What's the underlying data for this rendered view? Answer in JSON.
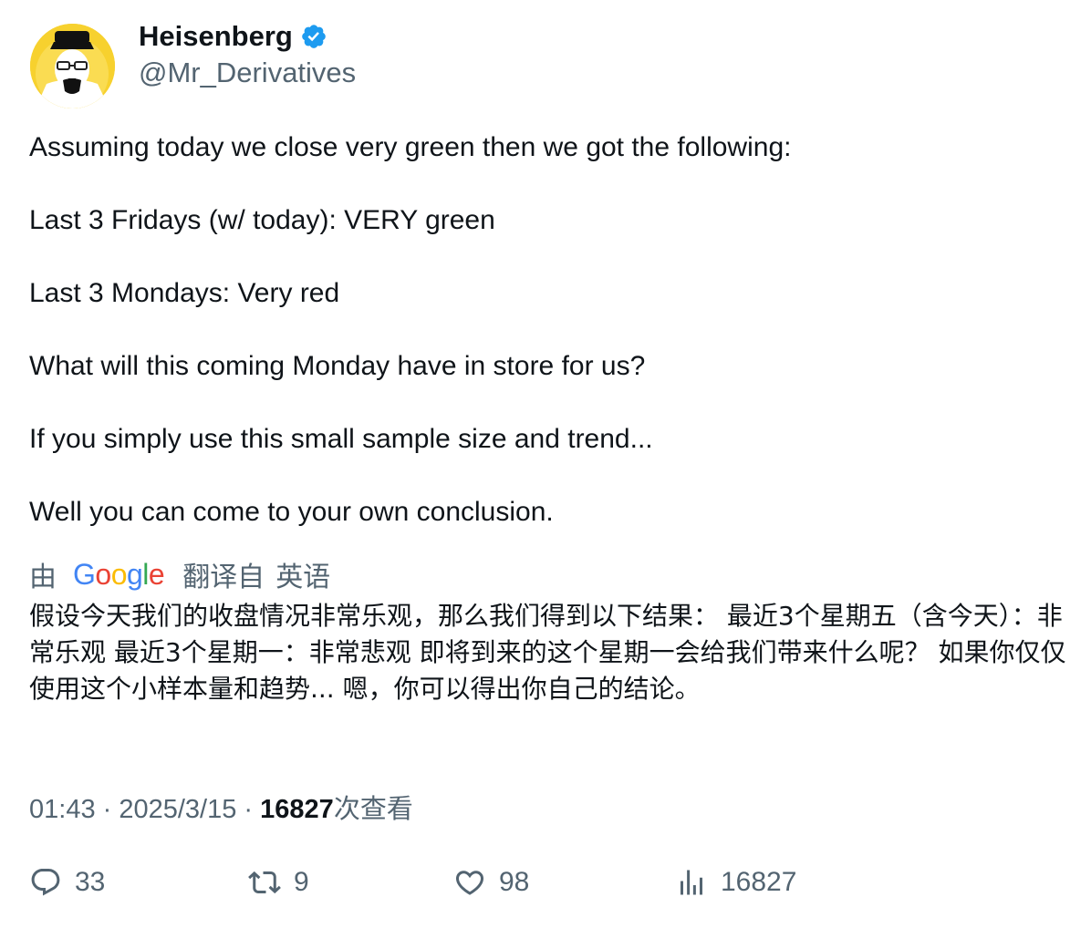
{
  "author": {
    "display_name": "Heisenberg",
    "handle": "@Mr_Derivatives",
    "verified": true,
    "avatar_icon": "heisenberg-avatar-icon",
    "verified_color": "#1d9bf0"
  },
  "tweet": {
    "paragraphs": [
      "Assuming today we close very green then we got the following:",
      "Last 3 Fridays (w/ today): VERY green",
      "Last 3 Mondays: Very red",
      "What will this coming Monday have in store for us?",
      "If you simply use this small sample size and trend...",
      "Well you can come to your own conclusion."
    ]
  },
  "translation": {
    "by_label": "由",
    "provider": "Google",
    "translated_from_label": "翻译自",
    "source_language": "英语",
    "text": "假设今天我们的收盘情况非常乐观，那么我们得到以下结果： 最近3个星期五（含今天）：非常乐观 最近3个星期一：非常悲观 即将到来的这个星期一会给我们带来什么呢？ 如果你仅仅使用这个小样本量和趋势... 嗯，你可以得出你自己的结论。"
  },
  "meta": {
    "time": "01:43",
    "separator": " · ",
    "date": "2025/3/15",
    "views": "16827",
    "views_label": "次查看"
  },
  "actions": {
    "replies": "33",
    "reposts": "9",
    "likes": "98",
    "views": "16827"
  },
  "colors": {
    "text_primary": "#0f1419",
    "text_secondary": "#536471",
    "accent": "#1d9bf0"
  }
}
